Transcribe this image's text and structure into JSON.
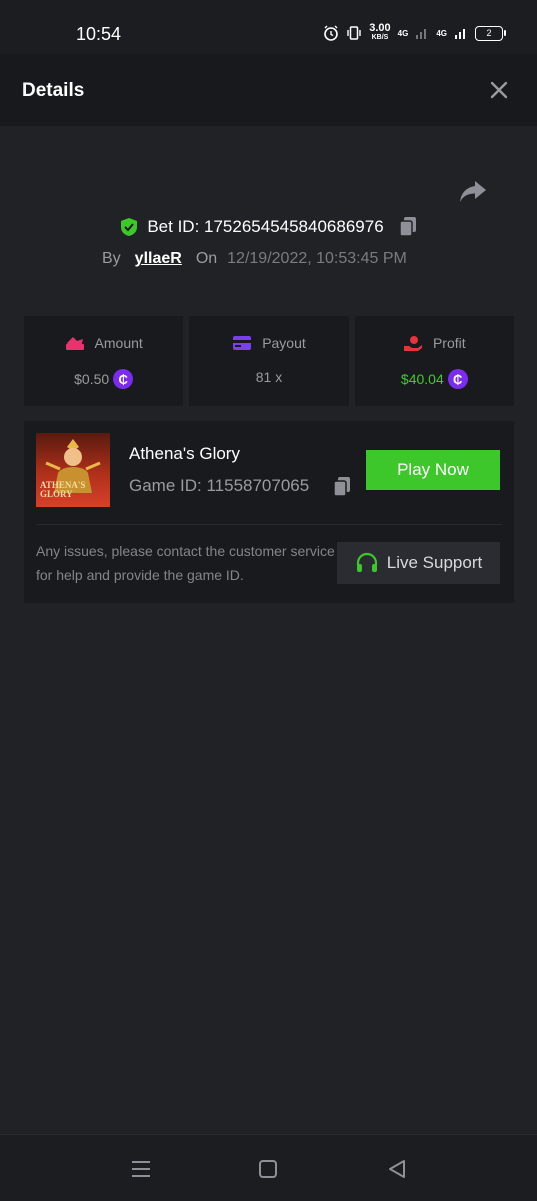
{
  "status_bar": {
    "time": "10:54",
    "speed_value": "3.00",
    "speed_unit": "KB/S",
    "net1": "4G",
    "net2": "4G",
    "battery": "2"
  },
  "header": {
    "title": "Details"
  },
  "bet": {
    "id_text": "Bet ID: 1752654545840686976",
    "by_label": "By",
    "user": "yllaeR",
    "on_label": "On",
    "date": "12/19/2022, 10:53:45 PM"
  },
  "stats": {
    "amount_label": "Amount",
    "amount_value": "$0.50",
    "payout_label": "Payout",
    "payout_value": "81 x",
    "profit_label": "Profit",
    "profit_value": "$40.04"
  },
  "game": {
    "name": "Athena's Glory",
    "id_text": "Game ID: 11558707065",
    "thumb_text_1": "ATHENA'S",
    "thumb_text_2": "GLORY",
    "play_label": "Play Now",
    "note": "Any issues, please contact the customer service for help and provide the game ID.",
    "support_label": "Live Support"
  },
  "colors": {
    "accent_green": "#3ec72b",
    "coin_purple": "#7b2cf0",
    "amount_pink": "#e8336e",
    "payout_purple": "#7b3ff2",
    "profit_red": "#e8333a"
  }
}
